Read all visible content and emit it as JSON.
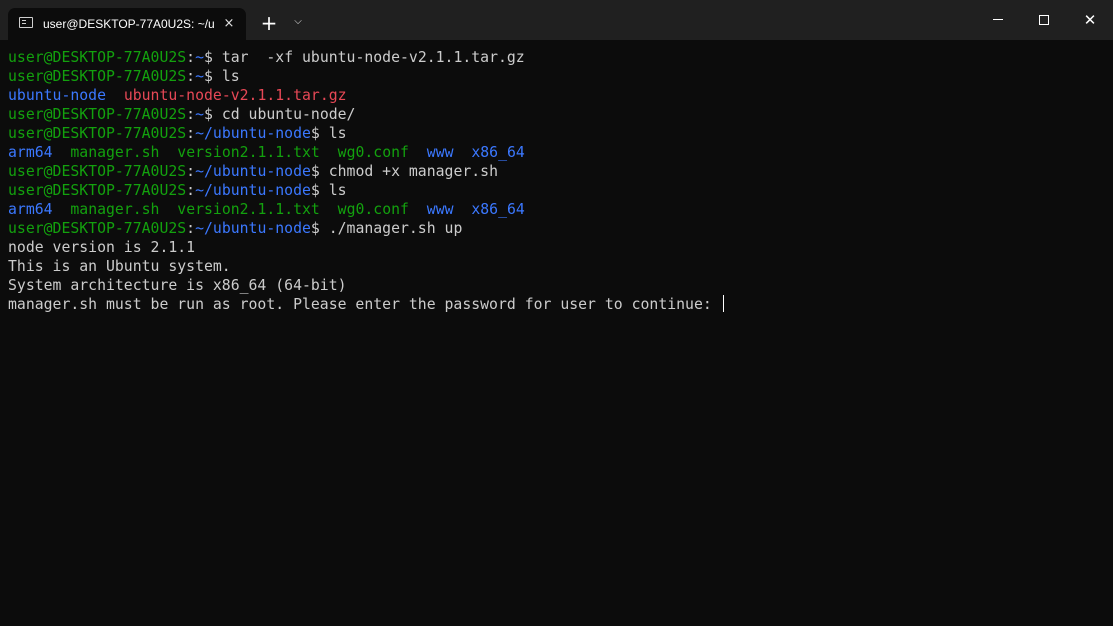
{
  "window": {
    "tab_title": "user@DESKTOP-77A0U2S: ~/u",
    "tab_close_icon": "×",
    "new_tab_icon": "+",
    "dropdown_icon": "⌵",
    "close_icon": "✕"
  },
  "colors": {
    "background": "#0c0c0c",
    "tabbar": "#202020",
    "green": "#13a10e",
    "blue": "#3b78ff",
    "red": "#e74856",
    "text": "#cccccc"
  },
  "terminal": {
    "lines": [
      [
        {
          "t": "user@DESKTOP-77A0U2S",
          "c": "green"
        },
        {
          "t": ":",
          "c": "white"
        },
        {
          "t": "~",
          "c": "blue"
        },
        {
          "t": "$ tar  -xf ubuntu-node-v2.1.1.tar.gz",
          "c": "white"
        }
      ],
      [
        {
          "t": "user@DESKTOP-77A0U2S",
          "c": "green"
        },
        {
          "t": ":",
          "c": "white"
        },
        {
          "t": "~",
          "c": "blue"
        },
        {
          "t": "$ ls",
          "c": "white"
        }
      ],
      [
        {
          "t": "ubuntu-node",
          "c": "blue"
        },
        {
          "t": "  ",
          "c": "white"
        },
        {
          "t": "ubuntu-node-v2.1.1.tar.gz",
          "c": "red"
        }
      ],
      [
        {
          "t": "user@DESKTOP-77A0U2S",
          "c": "green"
        },
        {
          "t": ":",
          "c": "white"
        },
        {
          "t": "~",
          "c": "blue"
        },
        {
          "t": "$ cd ubuntu-node/",
          "c": "white"
        }
      ],
      [
        {
          "t": "user@DESKTOP-77A0U2S",
          "c": "green"
        },
        {
          "t": ":",
          "c": "white"
        },
        {
          "t": "~/ubuntu-node",
          "c": "blue"
        },
        {
          "t": "$ ls",
          "c": "white"
        }
      ],
      [
        {
          "t": "arm64",
          "c": "blue"
        },
        {
          "t": "  ",
          "c": "white"
        },
        {
          "t": "manager.sh",
          "c": "green"
        },
        {
          "t": "  ",
          "c": "white"
        },
        {
          "t": "version2.1.1.txt",
          "c": "green"
        },
        {
          "t": "  ",
          "c": "white"
        },
        {
          "t": "wg0.conf",
          "c": "green"
        },
        {
          "t": "  ",
          "c": "white"
        },
        {
          "t": "www",
          "c": "blue"
        },
        {
          "t": "  ",
          "c": "white"
        },
        {
          "t": "x86_64",
          "c": "blue"
        }
      ],
      [
        {
          "t": "user@DESKTOP-77A0U2S",
          "c": "green"
        },
        {
          "t": ":",
          "c": "white"
        },
        {
          "t": "~/ubuntu-node",
          "c": "blue"
        },
        {
          "t": "$ chmod +x manager.sh",
          "c": "white"
        }
      ],
      [
        {
          "t": "user@DESKTOP-77A0U2S",
          "c": "green"
        },
        {
          "t": ":",
          "c": "white"
        },
        {
          "t": "~/ubuntu-node",
          "c": "blue"
        },
        {
          "t": "$ ls",
          "c": "white"
        }
      ],
      [
        {
          "t": "arm64",
          "c": "blue"
        },
        {
          "t": "  ",
          "c": "white"
        },
        {
          "t": "manager.sh",
          "c": "green"
        },
        {
          "t": "  ",
          "c": "white"
        },
        {
          "t": "version2.1.1.txt",
          "c": "green"
        },
        {
          "t": "  ",
          "c": "white"
        },
        {
          "t": "wg0.conf",
          "c": "green"
        },
        {
          "t": "  ",
          "c": "white"
        },
        {
          "t": "www",
          "c": "blue"
        },
        {
          "t": "  ",
          "c": "white"
        },
        {
          "t": "x86_64",
          "c": "blue"
        }
      ],
      [
        {
          "t": "user@DESKTOP-77A0U2S",
          "c": "green"
        },
        {
          "t": ":",
          "c": "white"
        },
        {
          "t": "~/ubuntu-node",
          "c": "blue"
        },
        {
          "t": "$ ./manager.sh up",
          "c": "white"
        }
      ],
      [
        {
          "t": "node version is 2.1.1",
          "c": "white"
        }
      ],
      [
        {
          "t": "This is an Ubuntu system.",
          "c": "white"
        }
      ],
      [
        {
          "t": "System architecture is x86_64 (64-bit)",
          "c": "white"
        }
      ],
      [
        {
          "t": "manager.sh must be run as root. Please enter the password for user to continue: ",
          "c": "white"
        }
      ]
    ]
  }
}
